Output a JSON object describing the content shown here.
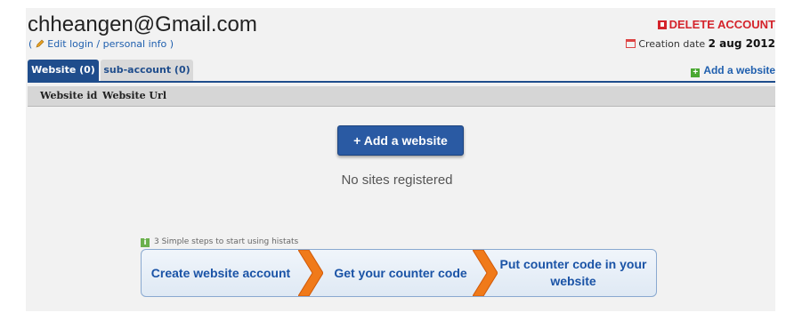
{
  "account": {
    "email": "chheangen@Gmail.com",
    "edit_open": "( ",
    "edit_label": "Edit login / personal info",
    "edit_close": " )",
    "delete_label": "DELETE ACCOUNT",
    "creation_label": "Creation date",
    "creation_date": "2 aug 2012"
  },
  "tabs": [
    {
      "label": "Website (0)",
      "active": true
    },
    {
      "label": "sub-account (0)",
      "active": false
    }
  ],
  "add_website_link": "Add a website",
  "table": {
    "columns": [
      "Website id",
      "Website Url"
    ]
  },
  "main": {
    "add_button": "+ Add a website",
    "empty_message": "No sites registered"
  },
  "steps": {
    "label": "3 Simple steps to start using histats",
    "items": [
      "Create website account",
      "Get your counter code",
      "Put counter code in your website"
    ]
  },
  "colors": {
    "accent": "#1f4d8c",
    "danger": "#d4232b",
    "arrow": "#f07a1a"
  }
}
